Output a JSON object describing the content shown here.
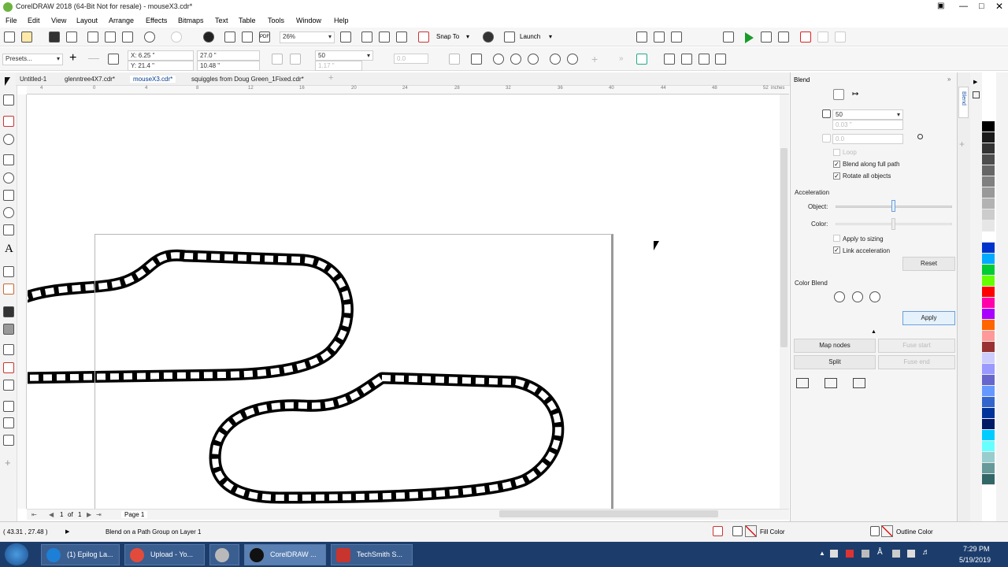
{
  "window": {
    "title": "CorelDRAW 2018 (64-Bit Not for resale) - mouseX3.cdr*"
  },
  "menu": [
    "File",
    "Edit",
    "View",
    "Layout",
    "Arrange",
    "Effects",
    "Bitmaps",
    "Text",
    "Table",
    "Tools",
    "Window",
    "Help"
  ],
  "toolbar": {
    "zoom": "26%",
    "snap": "Snap To",
    "launch": "Launch"
  },
  "propbar": {
    "presets": "Presets...",
    "x": "X: 6.25 \"",
    "y": "Y: 21.4 \"",
    "w": "27.0 \"",
    "h": "10.48 \"",
    "steps": "50",
    "spacing": "1.17 \"",
    "angle": "0.0"
  },
  "tabs": [
    "Untitled-1",
    "glenntree4X7.cdr*",
    "mouseX3.cdr*",
    "squiggles from Doug Green_1Fixed.cdr*"
  ],
  "ruler": {
    "unit": "inches",
    "ticks": [
      "4",
      "0",
      "4",
      "8",
      "12",
      "16",
      "20",
      "24",
      "28",
      "32",
      "36",
      "40",
      "44",
      "48",
      "52"
    ]
  },
  "blend": {
    "title": "Blend",
    "steps": "50",
    "spacing": "0.03 \"",
    "rotation": "0.0",
    "loop": "Loop",
    "blend_full_path": "Blend along full path",
    "rotate_all": "Rotate all objects",
    "acceleration": "Acceleration",
    "object": "Object:",
    "color": "Color:",
    "apply_sizing": "Apply to sizing",
    "link_accel": "Link acceleration",
    "reset": "Reset",
    "color_blend": "Color Blend",
    "apply": "Apply",
    "map_nodes": "Map nodes",
    "fuse_start": "Fuse start",
    "split": "Split",
    "fuse_end": "Fuse end",
    "object_value": 0.5,
    "color_value": 0.5
  },
  "docker_tab": "Blend",
  "pagenav": {
    "current": "1",
    "of": "of",
    "total": "1",
    "page_tab": "Page 1"
  },
  "status": {
    "coords": "( 43.31 , 27.48 )",
    "info": "Blend on a Path Group on Layer 1",
    "fill": "Fill Color",
    "outline": "Outline Color"
  },
  "taskbar": {
    "items": [
      {
        "label": "(1) Epilog La...",
        "color": "#1e7fd6"
      },
      {
        "label": "Upload - Yo...",
        "color": "#e24b3b"
      },
      {
        "label": "",
        "color": "#b9b9b9"
      },
      {
        "label": "CorelDRAW ...",
        "color": "#111111"
      },
      {
        "label": "TechSmith S...",
        "color": "#c8342e"
      }
    ],
    "time": "7:29 PM",
    "date": "5/19/2019"
  },
  "colors": {
    "palette": [
      "#ffffff",
      "#000000",
      "#1a1a1a",
      "#333333",
      "#4d4d4d",
      "#666666",
      "#808080",
      "#999999",
      "#b3b3b3",
      "#cccccc",
      "#e6e6e6",
      "#ffffff",
      "#0033cc",
      "#00aaff",
      "#00cc33",
      "#66ff00",
      "#ff0000",
      "#ff00aa",
      "#aa00ff",
      "#ff6600",
      "#ff9999",
      "#993333",
      "#ccccff",
      "#9999ff",
      "#6666cc",
      "#6699ff",
      "#3366cc",
      "#003399",
      "#001a66",
      "#00ccff",
      "#66ffff",
      "#99cccc",
      "#669999",
      "#336666"
    ]
  }
}
